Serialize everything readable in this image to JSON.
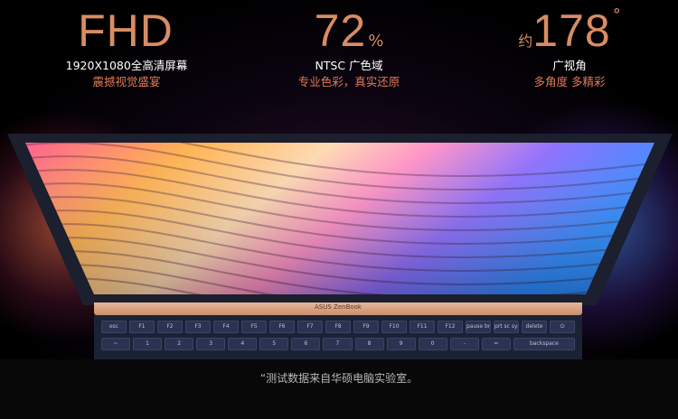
{
  "stats": [
    {
      "prefix": "",
      "value": "FHD",
      "suffix": "",
      "line1": "1920X1080全高清屏幕",
      "line2": "震撼视觉盛宴"
    },
    {
      "prefix": "",
      "value": "72",
      "suffix": "%",
      "line1": "NTSC  广色域",
      "line2": "专业色彩，真实还原"
    },
    {
      "prefix": "约",
      "value": "178",
      "suffix": "°",
      "line1": "广视角",
      "line2": "多角度 多精彩"
    }
  ],
  "laptop": {
    "brand": "ASUS ZenBook",
    "function_keys": [
      "esc",
      "F1",
      "F2",
      "F3",
      "F4",
      "F5",
      "F6",
      "F7",
      "F8",
      "F9",
      "F10",
      "F11",
      "F12",
      "pause break",
      "prt sc sysrq",
      "delete",
      "⏻"
    ],
    "number_keys": [
      "~",
      "1",
      "2",
      "3",
      "4",
      "5",
      "6",
      "7",
      "8",
      "9",
      "0",
      "-",
      "=",
      "backspace"
    ]
  },
  "footnote": "“测试数据来自华硕电脑实验室。"
}
